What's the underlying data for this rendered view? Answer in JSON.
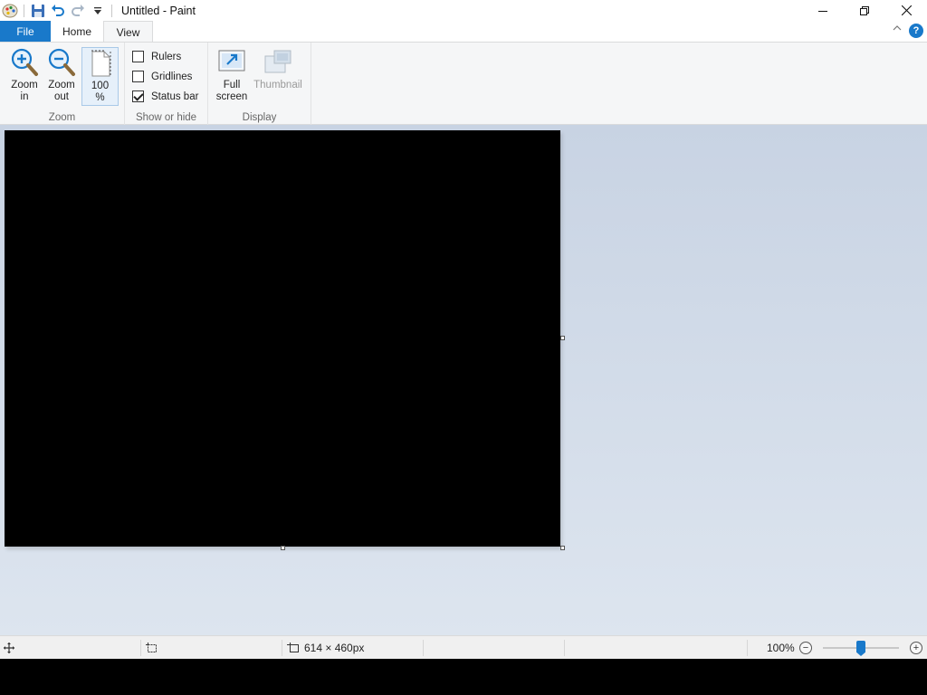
{
  "window": {
    "title": "Untitled - Paint"
  },
  "quick_access": {
    "icons": [
      "paint-app-icon",
      "save-icon",
      "undo-icon",
      "redo-icon",
      "customize-dropdown-icon"
    ]
  },
  "tabs": [
    {
      "label": "File",
      "active": false
    },
    {
      "label": "Home",
      "active": false
    },
    {
      "label": "View",
      "active": true
    }
  ],
  "ribbon": {
    "zoom_group": {
      "label": "Zoom",
      "zoom_in": "Zoom\nin",
      "zoom_out": "Zoom\nout",
      "hundred": "100\n%"
    },
    "show_hide_group": {
      "label": "Show or hide",
      "rulers": {
        "label": "Rulers",
        "checked": false
      },
      "gridlines": {
        "label": "Gridlines",
        "checked": false
      },
      "statusbar": {
        "label": "Status bar",
        "checked": true
      }
    },
    "display_group": {
      "label": "Display",
      "fullscreen": "Full\nscreen",
      "thumbnail": "Thumbnail"
    }
  },
  "canvas": {
    "background": "#000000"
  },
  "status_bar": {
    "image_size": "614 × 460px",
    "zoom_level": "100%"
  },
  "colors": {
    "accent": "#1979ca",
    "ribbon_bg": "#f5f6f7"
  }
}
